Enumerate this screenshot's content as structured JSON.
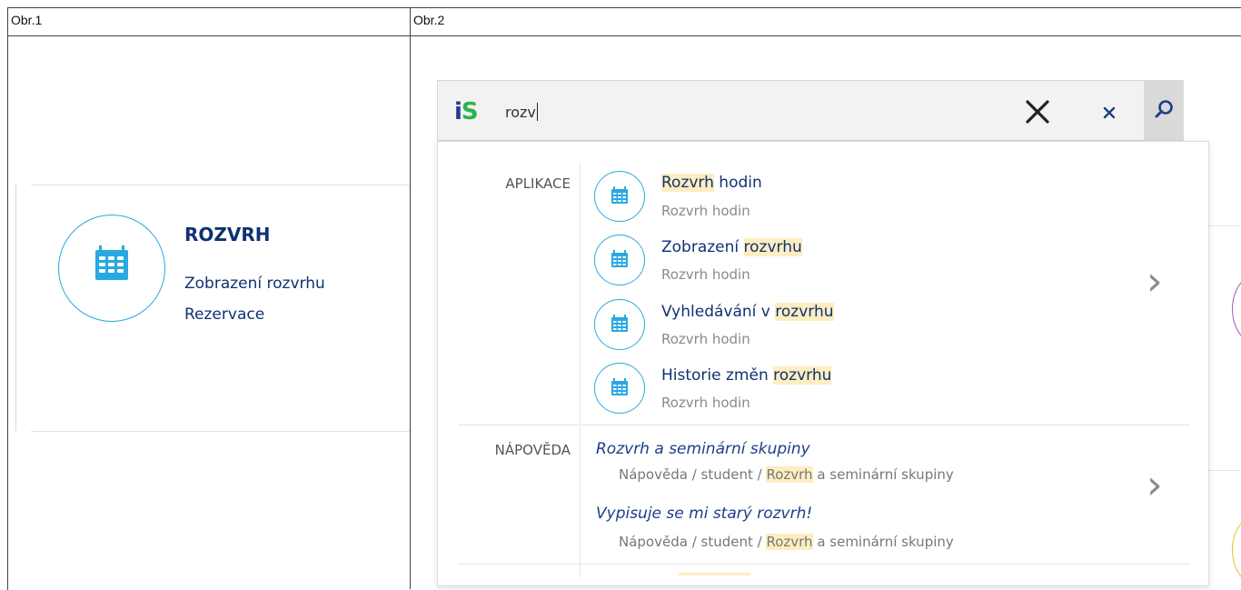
{
  "captions": {
    "left": "Obr.1",
    "right": "Obr.2"
  },
  "card": {
    "icon": "calendar-icon",
    "title": "ROZVRH",
    "links": [
      "Zobrazení rozvrhu",
      "Rezervace"
    ]
  },
  "search": {
    "logo_i": "i",
    "logo_s": "S",
    "query": "rozv",
    "clear_icon": "close-icon",
    "close_icon": "close-small-icon",
    "submit_icon": "search-icon"
  },
  "sections": {
    "apps_label": "APLIKACE",
    "help_label": "NÁPOVĚDA"
  },
  "apps": [
    {
      "before": "",
      "hl": "Rozvrh",
      "after": " hodin",
      "sub": "Rozvrh hodin"
    },
    {
      "before": "Zobrazení ",
      "hl": "rozvrhu",
      "after": "",
      "sub": "Rozvrh hodin"
    },
    {
      "before": "Vyhledávání v ",
      "hl": "rozvrhu",
      "after": "",
      "sub": "Rozvrh hodin"
    },
    {
      "before": "Historie změn ",
      "hl": "rozvrhu",
      "after": "",
      "sub": "Rozvrh hodin"
    }
  ],
  "help": [
    {
      "title_before": "",
      "title_hl": "Rozvrh",
      "title_after": " a seminární skupiny",
      "path_before": "Nápověda / student / ",
      "path_hl": "Rozvrh",
      "path_after": " a seminární skupiny"
    },
    {
      "title_before": "Vypisuje se mi starý ",
      "title_hl": "rozvrh",
      "title_after": "!",
      "path_before": "Nápověda / student / ",
      "path_hl": "Rozvrh",
      "path_after": " a seminární skupiny"
    }
  ],
  "colors": {
    "accent": "#29a9e1",
    "link": "#0f3270",
    "highlight": "#fdedc0",
    "logo_s": "#2cb34a"
  }
}
